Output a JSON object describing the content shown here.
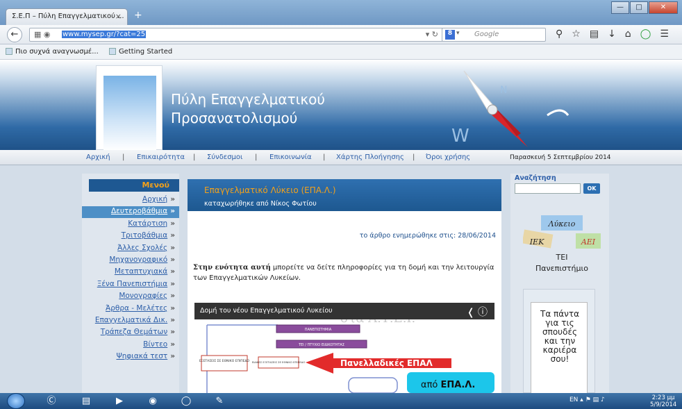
{
  "browser": {
    "tab_title": "Σ.Ε.Π – Πύλη Επαγγελματικού ...",
    "tab_close": "×",
    "new_tab": "+",
    "url": "www.mysep.gr/?cat=25",
    "search_placeholder": "Google",
    "bookmarks": [
      "Πιο συχνά αναγνωσμέ...",
      "Getting Started"
    ],
    "window_controls": [
      "minimize-icon",
      "maximize-icon",
      "close-icon"
    ]
  },
  "site": {
    "title_line1": "Πύλη Επαγγελματικού",
    "title_line2": "Προσανατολισμού",
    "top_menu": [
      "Αρχική",
      "Επικαιρότητα",
      "Σύνδεσμοι",
      "Επικοινωνία",
      "Χάρτης Πλοήγησης",
      "Όροι χρήσης"
    ],
    "separator": "|",
    "date": "Παρασκευή 5 Σεπτεμβρίου 2014"
  },
  "left_menu": {
    "heading": "Μενού",
    "arrow": "»",
    "items": [
      "Αρχική",
      "Δευτεροβάθμια",
      "Κατάρτιση",
      "Τριτοβάθμια",
      "Άλλες Σχολές",
      "Μηχανογραφικό",
      "Μεταπτυχιακά",
      "Ξένα Πανεπιστήμια",
      "Μονογραφίες",
      "Άρθρα - Μελέτες",
      "Επαγγελματικά Δικ.",
      "Τράπεζα Θεμάτων",
      "Βίντεο",
      "Ψηφιακά τεστ"
    ],
    "active_index": 1
  },
  "article": {
    "title": "Επαγγελματικό Λύκειο (ΕΠΑ.Λ.)",
    "author": "καταχωρήθηκε από Νίκος Φωτίου",
    "updated": "το άρθρο ενημερώθηκε στις: 28/06/2014",
    "para_bold": "Στην ενότητα αυτή",
    "para_rest": " μπορείτε να δείτε πληροφορίες για τη δομή και την λειτουργία των Επαγγελματικών Λυκείων.",
    "video_title": "Δομή του νέου Επαγγελματικού Λυκείου",
    "video_watermark": "στα Α.Τ.Ε.Ι.",
    "flow_box1": "ΠΑΝΕΠΙΣΤΗΜΙΑ",
    "flow_box2": "ΤΕΙ / ΠΤΥΧΙΟ ΕΙΔΙΚΟΤΗΤΑΣ",
    "flow_box3": "ΕΞΕΤΑΣΕΙΣ ΣΕ ΕΘΝΙΚΟ ΕΠΙΠΕΔΟ",
    "flow_box4": "ΕΙΔΙΚΕΣ ΕΞΕΤΑΣΕΙΣ ΣΕ ΕΘΝΙΚΟ ΕΠΙΠΕΔΟ",
    "flow_arrow_label": "Πανελλαδικές ΕΠΑΛ",
    "flow_from": "από",
    "flow_from_bold": "ΕΠΑ.Λ."
  },
  "right_col": {
    "search_label": "Αναζήτηση",
    "ok": "ΟΚ",
    "promo1": [
      "Λύκειο",
      "ΙΕΚ",
      "ΑΕΙ",
      "ΤΕΙ",
      "Πανεπιστήμιο"
    ],
    "promo2": [
      "Τα πάντα",
      "για τις",
      "σπουδές",
      "και την",
      "καριέρα",
      "σου!"
    ]
  },
  "taskbar": {
    "lang": "EN",
    "time": "2:23 μμ",
    "date": "5/9/2014"
  }
}
